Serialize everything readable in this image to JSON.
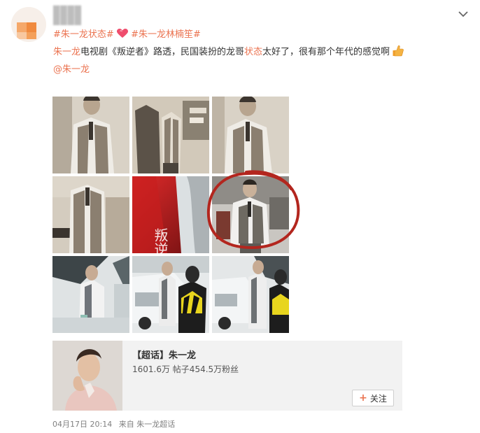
{
  "post": {
    "hashtag_1": "#朱一龙状态#",
    "hashtag_2": "#朱一龙林楠笙#",
    "body_name": "朱一龙",
    "body_text_1": "电视剧《叛逆者》路透，民国装扮的龙哥",
    "body_keyword": "状态",
    "body_text_2": "太好了，很有那个年代的感觉啊",
    "mention": "@朱一龙",
    "poster_text": "叛逆者"
  },
  "super_topic_card": {
    "title": "【超话】朱一龙",
    "stats": "1601.6万 帖子454.5万粉丝",
    "follow_label": "关注"
  },
  "footer": {
    "date": "04月17日 20:14",
    "from_label": "来自",
    "source": "朱一龙超话"
  },
  "colors": {
    "link": "#eb7350",
    "highlight_circle": "#b3261e"
  },
  "icons": [
    "chevron-down-icon",
    "heart-icon",
    "thumbs-up-icon",
    "plus-icon"
  ]
}
